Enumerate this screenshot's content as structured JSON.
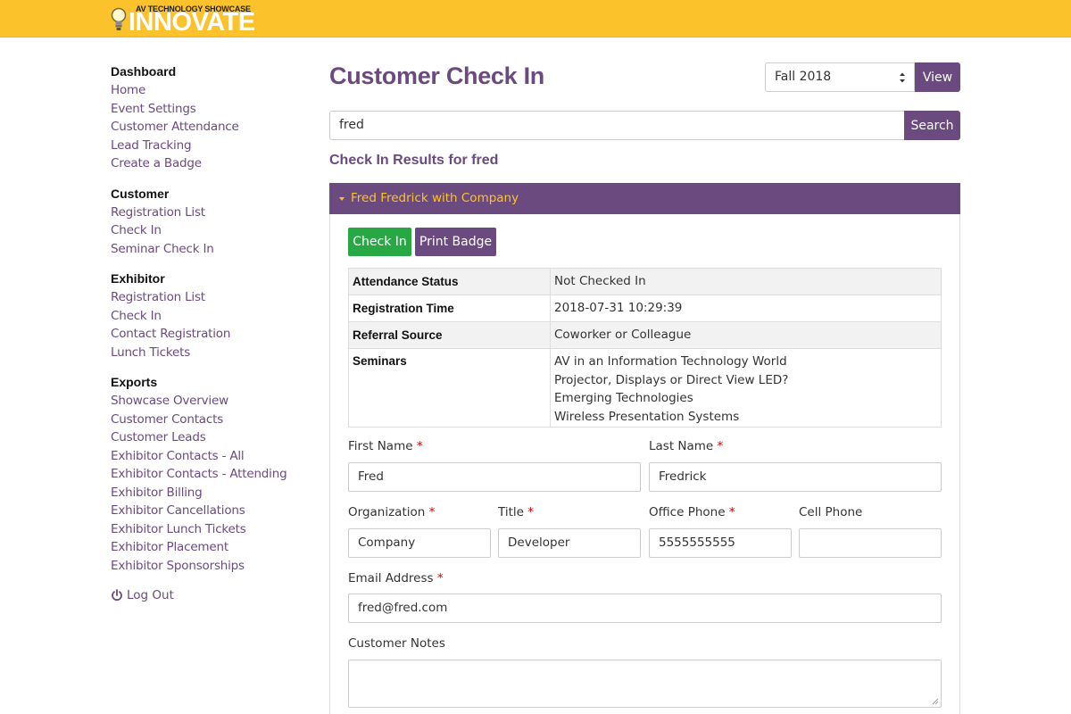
{
  "brand": {
    "tagline": "AV TECHNOLOGY SHOWCASE",
    "name": "INNOVATE",
    "primary_color": "#6b4a80",
    "accent_color": "#fcc22b",
    "success_color": "#28a745"
  },
  "sidebar": {
    "groups": [
      {
        "title": "Dashboard",
        "items": [
          "Home",
          "Event Settings",
          "Customer Attendance",
          "Lead Tracking",
          "Create a Badge"
        ]
      },
      {
        "title": "Customer",
        "items": [
          "Registration List",
          "Check In",
          "Seminar Check In"
        ]
      },
      {
        "title": "Exhibitor",
        "items": [
          "Registration List",
          "Check In",
          "Contact Registration",
          "Lunch Tickets"
        ]
      },
      {
        "title": "Exports",
        "items": [
          "Showcase Overview",
          "Customer Contacts",
          "Customer Leads",
          "Exhibitor Contacts - All",
          "Exhibitor Contacts - Attending",
          "Exhibitor Billing",
          "Exhibitor Cancellations",
          "Exhibitor Lunch Tickets",
          "Exhibitor Placement",
          "Exhibitor Sponsorships"
        ]
      }
    ],
    "logout_label": "Log Out",
    "logout_icon": "power-icon"
  },
  "header": {
    "title": "Customer Check In",
    "season_selected": "Fall 2018",
    "view_label": "View"
  },
  "search": {
    "value": "fred",
    "button_label": "Search"
  },
  "results": {
    "heading": "Check In Results for fred",
    "panel_title": "Fred Fredrick with Company",
    "checkin_label": "Check In",
    "print_badge_label": "Print Badge",
    "table": {
      "attendance_key": "Attendance Status",
      "attendance_value": "Not Checked In",
      "registration_key": "Registration Time",
      "registration_value": "2018-07-31 10:29:39",
      "referral_key": "Referral Source",
      "referral_value": "Coworker or Colleague",
      "seminars_key": "Seminars",
      "seminars": [
        "AV in an Information Technology World",
        "Projector, Displays or Direct View LED?",
        "Emerging Technologies",
        "Wireless Presentation Systems"
      ]
    }
  },
  "form": {
    "first_name_label": "First Name",
    "first_name_value": "Fred",
    "last_name_label": "Last Name",
    "last_name_value": "Fredrick",
    "organization_label": "Organization",
    "organization_value": "Company",
    "title_label": "Title",
    "title_value": "Developer",
    "office_phone_label": "Office Phone",
    "office_phone_value": "5555555555",
    "cell_phone_label": "Cell Phone",
    "cell_phone_value": "",
    "email_label": "Email Address",
    "email_value": "fred@fred.com",
    "notes_label": "Customer Notes",
    "notes_value": "",
    "required_mark": "*"
  }
}
